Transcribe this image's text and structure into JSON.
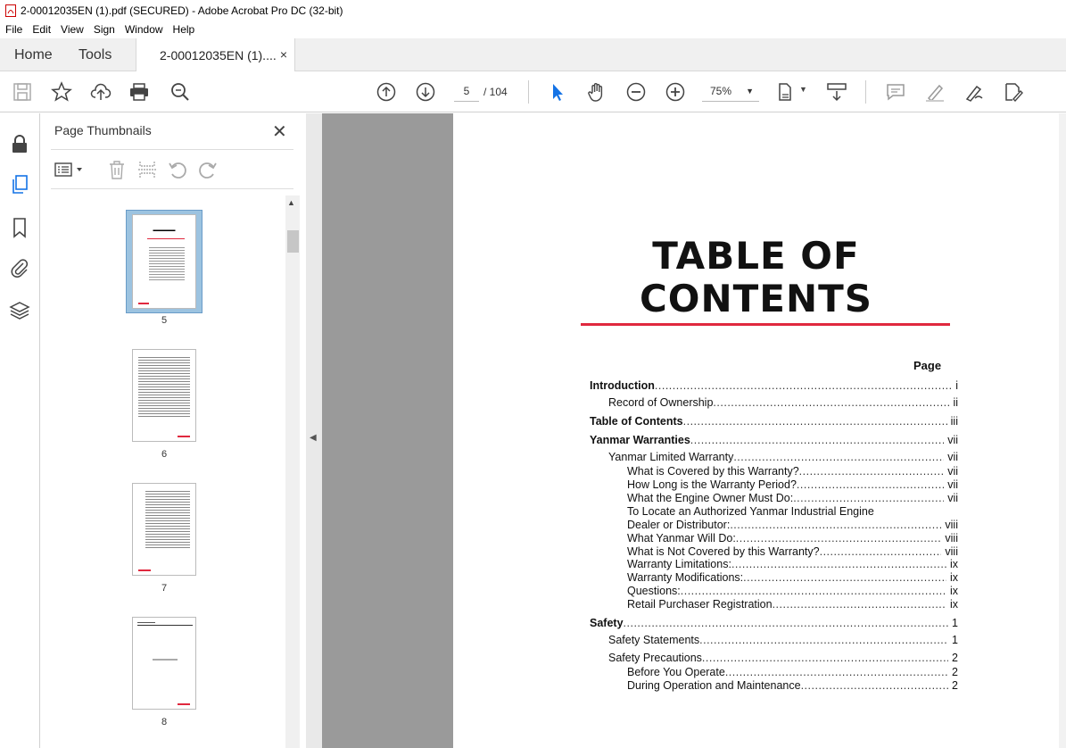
{
  "window": {
    "title": "2-00012035EN (1).pdf (SECURED) - Adobe Acrobat Pro DC (32-bit)"
  },
  "menu": [
    "File",
    "Edit",
    "View",
    "Sign",
    "Window",
    "Help"
  ],
  "tabs": {
    "home": "Home",
    "tools": "Tools",
    "doc": "2-00012035EN (1)....",
    "close": "×"
  },
  "toolbar": {
    "page_current": "5",
    "page_total": "/ 104",
    "zoom": "75%"
  },
  "panel": {
    "title": "Page Thumbnails",
    "thumbnails": [
      {
        "label": "5",
        "selected": true
      },
      {
        "label": "6",
        "selected": false
      },
      {
        "label": "7",
        "selected": false
      },
      {
        "label": "8",
        "selected": false
      }
    ]
  },
  "document": {
    "title_line1": "TABLE OF",
    "title_line2": "CONTENTS",
    "page_header": "Page",
    "entries": [
      {
        "text": "Introduction",
        "page": "i",
        "level": 0
      },
      {
        "text": "Record of Ownership",
        "page": "ii",
        "level": 1
      },
      {
        "text": "Table of Contents",
        "page": "iii",
        "level": 0
      },
      {
        "text": "Yanmar Warranties",
        "page": "vii",
        "level": 0
      },
      {
        "text": "Yanmar Limited Warranty",
        "page": "vii",
        "level": 1
      },
      {
        "text": "What is Covered by this Warranty?",
        "page": "vii",
        "level": 2
      },
      {
        "text": "How Long is the Warranty Period?",
        "page": "vii",
        "level": 2
      },
      {
        "text": "What the Engine Owner Must Do:",
        "page": "vii",
        "level": 2
      },
      {
        "text": "To Locate an Authorized Yanmar Industrial Engine",
        "page": "",
        "level": 2
      },
      {
        "text": "Dealer or Distributor:",
        "page": "viii",
        "level": 2
      },
      {
        "text": "What Yanmar Will Do:",
        "page": "viii",
        "level": 2
      },
      {
        "text": "What is Not Covered by this Warranty?",
        "page": "viii",
        "level": 2
      },
      {
        "text": "Warranty Limitations:",
        "page": "ix",
        "level": 2
      },
      {
        "text": "Warranty Modifications:",
        "page": "ix",
        "level": 2
      },
      {
        "text": "Questions:",
        "page": "ix",
        "level": 2
      },
      {
        "text": "Retail Purchaser Registration",
        "page": "ix",
        "level": 2
      },
      {
        "text": "Safety",
        "page": "1",
        "level": 0
      },
      {
        "text": "Safety Statements",
        "page": "1",
        "level": 1
      },
      {
        "text": "Safety Precautions",
        "page": "2",
        "level": 1
      },
      {
        "text": "Before You Operate",
        "page": "2",
        "level": 2
      },
      {
        "text": "During Operation and Maintenance",
        "page": "2",
        "level": 2
      }
    ]
  },
  "colors": {
    "accent_red": "#e0283e",
    "thumb_selected": "#9cc3e0"
  },
  "icons": [
    "pdf-icon",
    "save-icon",
    "star-icon",
    "upload-icon",
    "print-icon",
    "zoom-search-icon",
    "arrow-up-icon",
    "arrow-down-icon",
    "select-cursor-icon",
    "hand-icon",
    "zoom-out-icon",
    "zoom-in-icon",
    "fit-page-icon",
    "scroll-mode-icon",
    "comment-icon",
    "highlight-icon",
    "sign-icon",
    "edit-icon",
    "lock-icon",
    "pages-icon",
    "bookmark-icon",
    "attachment-icon",
    "layers-icon",
    "options-icon",
    "delete-icon",
    "extract-icon",
    "rotate-ccw-icon",
    "rotate-cw-icon"
  ]
}
